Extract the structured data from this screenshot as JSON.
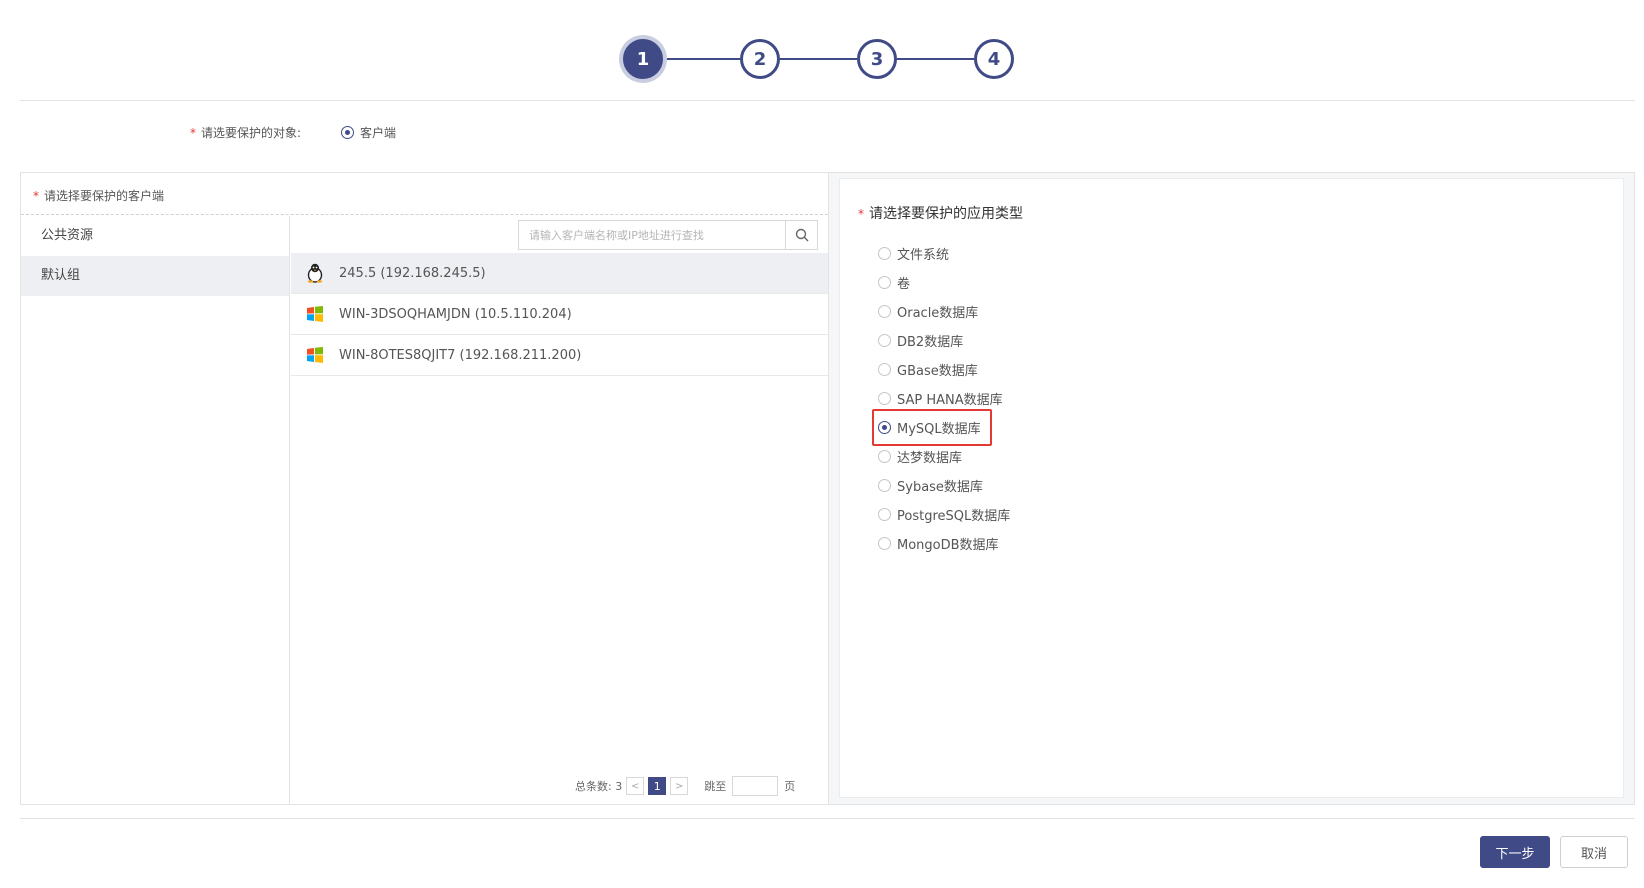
{
  "stepper": {
    "steps": [
      "1",
      "2",
      "3",
      "4"
    ],
    "active_step": 1,
    "color": "#3f4a86"
  },
  "target": {
    "label": "请选要保护的对象:",
    "option": "客户端",
    "selected": true
  },
  "clients_panel": {
    "header": "请选择要保护的客户端",
    "search_placeholder": "请输入客户端名称或IP地址进行查找",
    "groups": [
      {
        "label": "公共资源",
        "selected": false
      },
      {
        "label": "默认组",
        "selected": true
      }
    ],
    "clients": [
      {
        "label": "245.5 (192.168.245.5)",
        "os": "linux-icon",
        "selected": true
      },
      {
        "label": "WIN-3DSOQHAMJDN (10.5.110.204)",
        "os": "windows-icon",
        "selected": false
      },
      {
        "label": "WIN-8OTES8QJIT7 (192.168.211.200)",
        "os": "windows-icon",
        "selected": false
      }
    ],
    "pager": {
      "total_label": "总条数: 3",
      "prev": "<",
      "current": "1",
      "next": ">",
      "jump_label": "跳至",
      "page_suffix": "页"
    }
  },
  "app_panel": {
    "header": "请选择要保护的应用类型",
    "types": [
      {
        "label": "文件系统",
        "selected": false
      },
      {
        "label": "卷",
        "selected": false
      },
      {
        "label": "Oracle数据库",
        "selected": false
      },
      {
        "label": "DB2数据库",
        "selected": false
      },
      {
        "label": "GBase数据库",
        "selected": false
      },
      {
        "label": "SAP HANA数据库",
        "selected": false
      },
      {
        "label": "MySQL数据库",
        "selected": true
      },
      {
        "label": "达梦数据库",
        "selected": false
      },
      {
        "label": "Sybase数据库",
        "selected": false
      },
      {
        "label": "PostgreSQL数据库",
        "selected": false
      },
      {
        "label": "MongoDB数据库",
        "selected": false
      }
    ],
    "highlight_color": "#e53935"
  },
  "footer": {
    "next_label": "下一步",
    "cancel_label": "取消"
  }
}
